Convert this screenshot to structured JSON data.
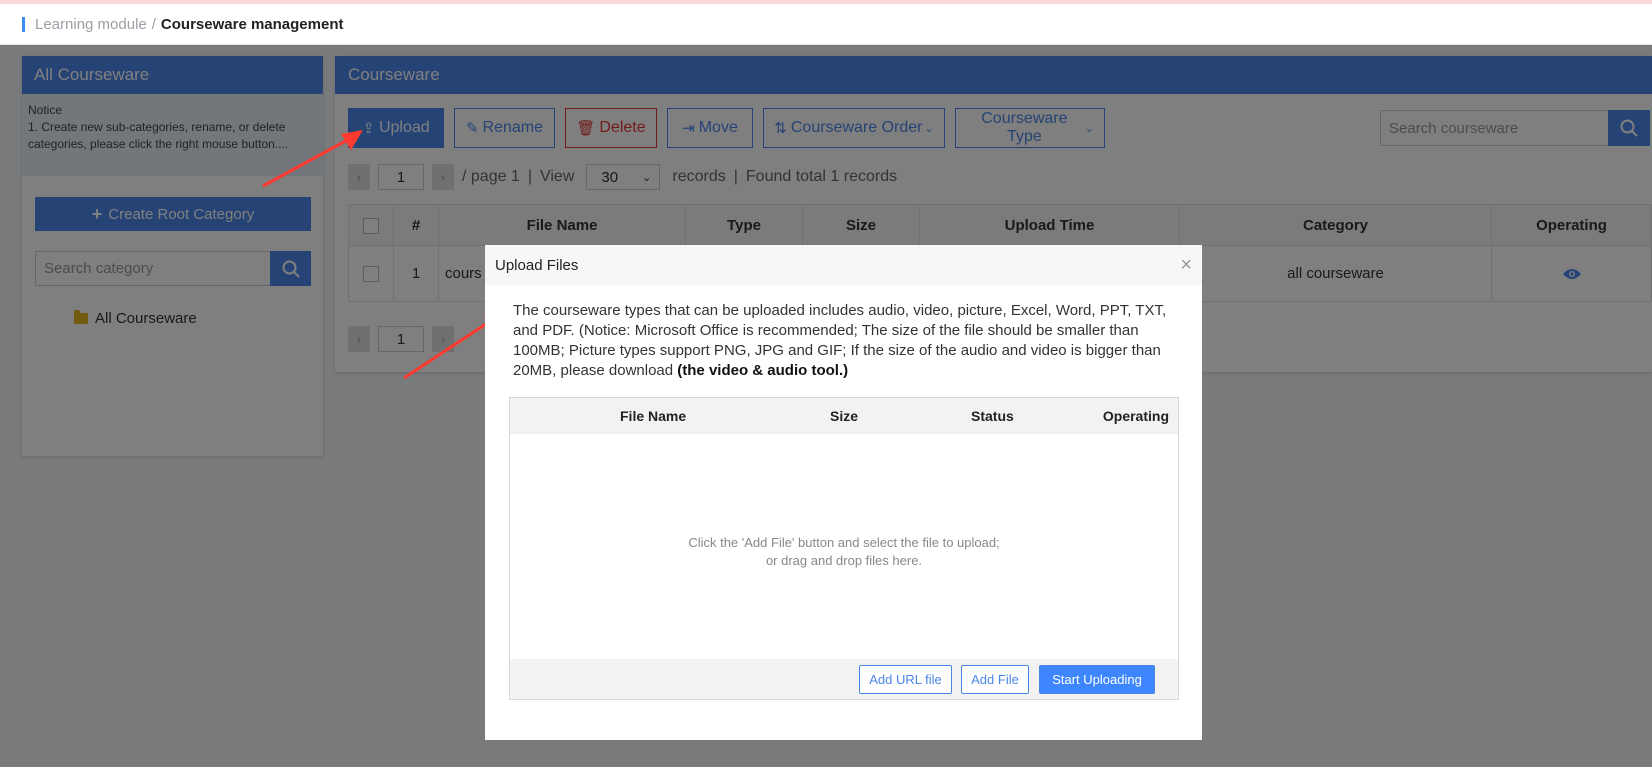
{
  "breadcrumb": {
    "parent": "Learning module",
    "separator": "/",
    "current": "Courseware management"
  },
  "left_panel": {
    "title": "All Courseware",
    "notice_title": "Notice",
    "notice_text": "1. Create new sub-categories, rename, or delete categories, please click the right mouse button....",
    "create_root_label": "Create Root Category",
    "search_placeholder": "Search category",
    "tree": [
      {
        "label": "All Courseware",
        "icon": "folder-icon"
      }
    ]
  },
  "right_panel": {
    "title": "Courseware",
    "toolbar": {
      "upload": "Upload",
      "rename": "Rename",
      "delete": "Delete",
      "move": "Move",
      "order": "Courseware Order",
      "type": "Courseware Type"
    },
    "search_placeholder": "Search courseware",
    "pager": {
      "page": "1",
      "of_page": "/ page 1",
      "view": "View",
      "per_page": "30",
      "records": "records",
      "found": "Found total 1 records"
    },
    "table": {
      "headers": [
        "#",
        "File Name",
        "Type",
        "Size",
        "Upload Time",
        "Category",
        "Operating"
      ],
      "rows": [
        {
          "index": "1",
          "file_name": "cours",
          "category": "all courseware"
        }
      ]
    }
  },
  "modal": {
    "title": "Upload Files",
    "desc_main": "The courseware types that can be uploaded includes audio, video, picture, Excel, Word, PPT, TXT, and PDF.  (Notice: Microsoft Office is recommended;  The size of the file should be smaller than 100MB;  Picture types support PNG, JPG and GIF;  If the size of the audio and video is bigger than 20MB, please download ",
    "desc_link": "(the video & audio tool.)",
    "columns": {
      "file_name": "File Name",
      "size": "Size",
      "status": "Status",
      "operating": "Operating"
    },
    "hint_line1": "Click the 'Add File' button and select the file to upload;",
    "hint_line2": "or drag and drop files here.",
    "buttons": {
      "add_url": "Add URL file",
      "add_file": "Add File",
      "start": "Start Uploading"
    }
  },
  "colors": {
    "accent": "#4a86e8",
    "danger": "#e53935",
    "annotation_arrow": "#ff3b30"
  }
}
